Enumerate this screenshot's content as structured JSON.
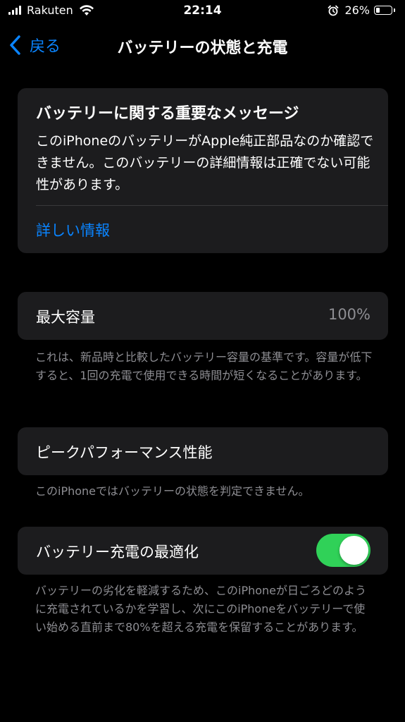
{
  "status_bar": {
    "carrier": "Rakuten",
    "time": "22:14",
    "battery_percent": "26%",
    "battery_level": 0.26,
    "icons": [
      "signal-icon",
      "wifi-icon",
      "alarm-icon",
      "battery-icon"
    ]
  },
  "nav": {
    "back_label": "戻る",
    "title": "バッテリーの状態と充電"
  },
  "message": {
    "title": "バッテリーに関する重要なメッセージ",
    "body": "このiPhoneのバッテリーがApple純正部品なのか確認できません。このバッテリーの詳細情報は正確でない可能性があります。",
    "link": "詳しい情報"
  },
  "capacity": {
    "label": "最大容量",
    "value": "100%",
    "note": "これは、新品時と比較したバッテリー容量の基準です。容量が低下すると、1回の充電で使用できる時間が短くなることがあります。"
  },
  "peak": {
    "label": "ピークパフォーマンス性能",
    "note": "このiPhoneではバッテリーの状態を判定できません。"
  },
  "optimize": {
    "label": "バッテリー充電の最適化",
    "enabled": true,
    "note": "バッテリーの劣化を軽減するため、このiPhoneが日ごろどのように充電されているかを学習し、次にこのiPhoneをバッテリーで使い始める直前まで80%を超える充電を保留することがあります。"
  },
  "colors": {
    "accent": "#0a84ff",
    "toggle_on": "#30d158",
    "card_bg": "#1c1c1e",
    "secondary_text": "#8e8e93"
  }
}
